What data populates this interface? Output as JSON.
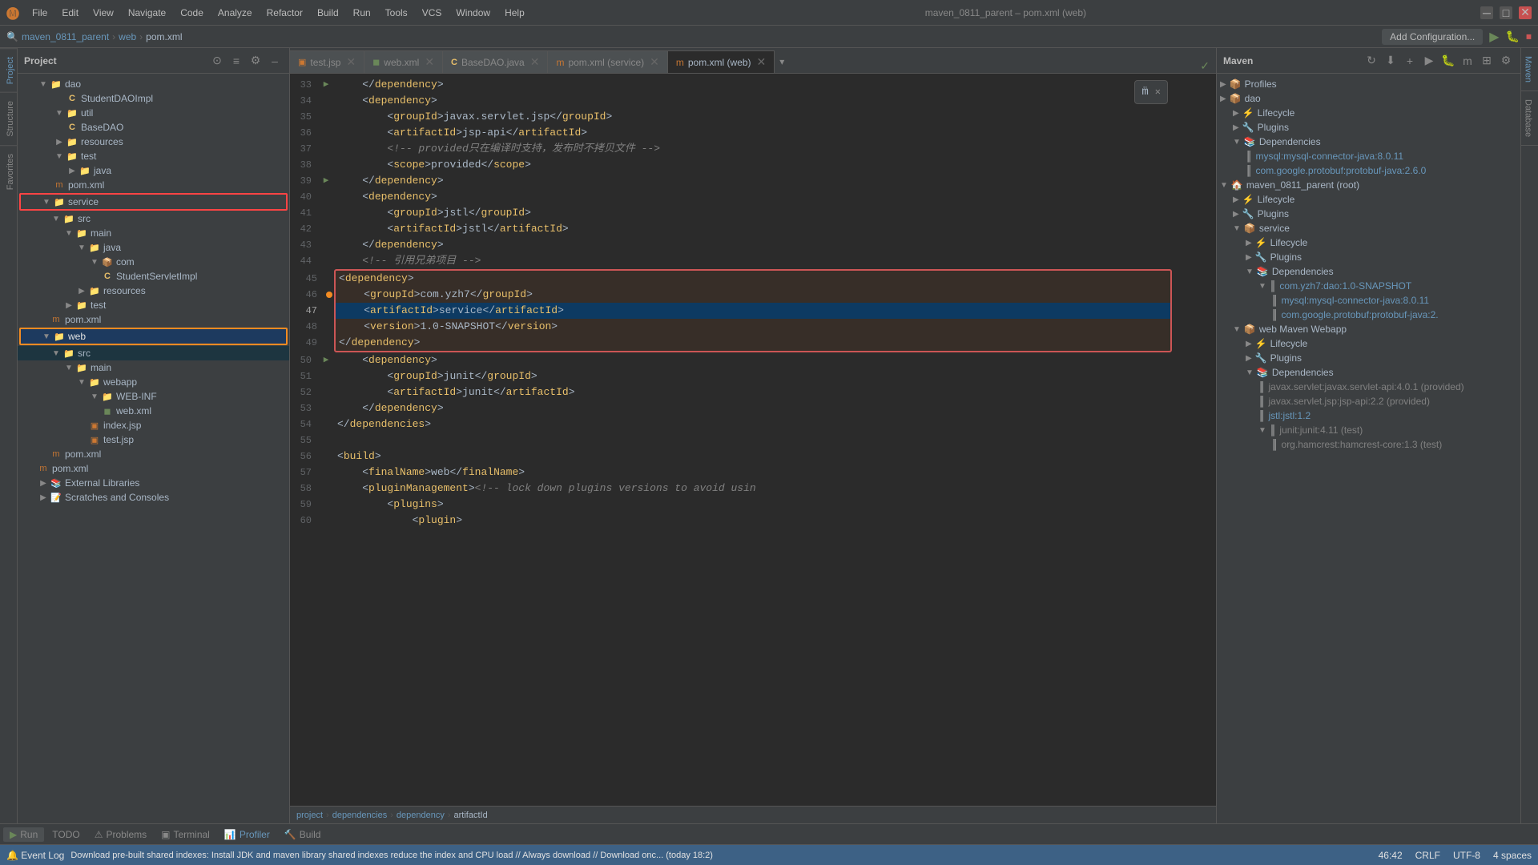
{
  "titlebar": {
    "project": "maven_0811_parent",
    "separator1": "–",
    "file": "pom.xml (web)",
    "logo": "🅜"
  },
  "menu": {
    "items": [
      "File",
      "Edit",
      "View",
      "Navigate",
      "Code",
      "Analyze",
      "Refactor",
      "Build",
      "Run",
      "Tools",
      "VCS",
      "Window",
      "Help"
    ]
  },
  "breadcrumb": {
    "parts": [
      "maven_0811_parent",
      "web",
      "pom.xml"
    ]
  },
  "tabs": [
    {
      "label": "test.jsp",
      "icon": "jsp",
      "active": false,
      "closable": true
    },
    {
      "label": "web.xml",
      "icon": "xml",
      "active": false,
      "closable": true
    },
    {
      "label": "BaseDAO.java",
      "icon": "java",
      "active": false,
      "closable": true
    },
    {
      "label": "pom.xml (service)",
      "icon": "xml",
      "active": false,
      "closable": true
    },
    {
      "label": "pom.xml (web)",
      "icon": "xml",
      "active": true,
      "closable": true
    }
  ],
  "editor": {
    "lines": [
      {
        "num": 33,
        "content": "    </dependency>",
        "type": "normal"
      },
      {
        "num": 34,
        "content": "    <dependency>",
        "type": "normal"
      },
      {
        "num": 35,
        "content": "        <groupId>javax.servlet.jsp</groupId>",
        "type": "normal"
      },
      {
        "num": 36,
        "content": "        <artifactId>jsp-api</artifactId>",
        "type": "normal"
      },
      {
        "num": 37,
        "content": "        <!-- provided只在编译时支持，发布时不拷贝文件 -->",
        "type": "comment"
      },
      {
        "num": 38,
        "content": "        <scope>provided</scope>",
        "type": "normal"
      },
      {
        "num": 39,
        "content": "    </dependency>",
        "type": "normal",
        "gutter": true
      },
      {
        "num": 40,
        "content": "    <dependency>",
        "type": "normal"
      },
      {
        "num": 41,
        "content": "        <groupId>jstl</groupId>",
        "type": "normal"
      },
      {
        "num": 42,
        "content": "        <artifactId>jstl</artifactId>",
        "type": "normal"
      },
      {
        "num": 43,
        "content": "    </dependency>",
        "type": "normal"
      },
      {
        "num": 44,
        "content": "    <!-- 引用兄弟项目 -->",
        "type": "comment"
      },
      {
        "num": 45,
        "content": "    <dependency>",
        "type": "highlight"
      },
      {
        "num": 46,
        "content": "        <groupId>com.yzh7</groupId>",
        "type": "highlight"
      },
      {
        "num": 47,
        "content": "        <artifactId>service</artifactId>",
        "type": "highlight-current"
      },
      {
        "num": 48,
        "content": "        <version>1.0-SNAPSHOT</version>",
        "type": "highlight"
      },
      {
        "num": 49,
        "content": "    </dependency>",
        "type": "highlight"
      },
      {
        "num": 50,
        "content": "    <dependency>",
        "type": "normal",
        "gutter": true
      },
      {
        "num": 51,
        "content": "        <groupId>junit</groupId>",
        "type": "normal"
      },
      {
        "num": 52,
        "content": "        <artifactId>junit</artifactId>",
        "type": "normal"
      },
      {
        "num": 53,
        "content": "    </dependency>",
        "type": "normal"
      },
      {
        "num": 54,
        "content": "</dependencies>",
        "type": "normal"
      },
      {
        "num": 55,
        "content": "",
        "type": "normal"
      },
      {
        "num": 56,
        "content": "<build>",
        "type": "normal"
      },
      {
        "num": 57,
        "content": "    <finalName>web</finalName>",
        "type": "normal"
      },
      {
        "num": 58,
        "content": "    <pluginManagement><!-- lock down plugins versions to avoid usin",
        "type": "normal"
      },
      {
        "num": 59,
        "content": "        <plugins>",
        "type": "normal"
      },
      {
        "num": 60,
        "content": "            <plugin>",
        "type": "normal"
      }
    ]
  },
  "sidebar": {
    "title": "Project",
    "items": [
      {
        "label": "dao",
        "type": "folder",
        "indent": 1,
        "expanded": true
      },
      {
        "label": "StudentDAOImpl",
        "type": "java",
        "indent": 3
      },
      {
        "label": "util",
        "type": "folder",
        "indent": 2,
        "expanded": true
      },
      {
        "label": "BaseDAO",
        "type": "java",
        "indent": 3
      },
      {
        "label": "resources",
        "type": "folder",
        "indent": 2
      },
      {
        "label": "test",
        "type": "folder",
        "indent": 2,
        "expanded": true
      },
      {
        "label": "java",
        "type": "folder-src",
        "indent": 3
      },
      {
        "label": "pom.xml",
        "type": "xml",
        "indent": 2
      },
      {
        "label": "service",
        "type": "folder",
        "indent": 1,
        "expanded": true,
        "highlighted": true
      },
      {
        "label": "src",
        "type": "folder-src",
        "indent": 2,
        "expanded": true
      },
      {
        "label": "main",
        "type": "folder",
        "indent": 3,
        "expanded": true
      },
      {
        "label": "java",
        "type": "folder-src",
        "indent": 4,
        "expanded": true
      },
      {
        "label": "com",
        "type": "pkg",
        "indent": 5,
        "expanded": true
      },
      {
        "label": "StudentServletImpl",
        "type": "java",
        "indent": 6
      },
      {
        "label": "resources",
        "type": "folder",
        "indent": 4
      },
      {
        "label": "test",
        "type": "folder",
        "indent": 3
      },
      {
        "label": "pom.xml",
        "type": "xml",
        "indent": 2
      },
      {
        "label": "web",
        "type": "folder",
        "indent": 1,
        "expanded": true,
        "selected": true
      },
      {
        "label": "src",
        "type": "folder-src",
        "indent": 2,
        "expanded": true
      },
      {
        "label": "main",
        "type": "folder",
        "indent": 3,
        "expanded": true
      },
      {
        "label": "webapp",
        "type": "folder",
        "indent": 4,
        "expanded": true
      },
      {
        "label": "WEB-INF",
        "type": "folder",
        "indent": 5,
        "expanded": true
      },
      {
        "label": "web.xml",
        "type": "xml",
        "indent": 6
      },
      {
        "label": "index.jsp",
        "type": "jsp",
        "indent": 5
      },
      {
        "label": "test.jsp",
        "type": "jsp",
        "indent": 5
      },
      {
        "label": "pom.xml",
        "type": "xml",
        "indent": 2
      },
      {
        "label": "pom.xml",
        "type": "xml",
        "indent": 1
      },
      {
        "label": "External Libraries",
        "type": "lib",
        "indent": 1
      },
      {
        "label": "Scratches and Consoles",
        "type": "lib",
        "indent": 1
      }
    ]
  },
  "maven": {
    "title": "Maven",
    "sections": [
      {
        "label": "Profiles",
        "expanded": true
      },
      {
        "label": "dao",
        "expanded": false
      },
      {
        "label": "Lifecycle",
        "expanded": false
      },
      {
        "label": "Plugins",
        "expanded": false
      },
      {
        "label": "Dependencies",
        "expanded": true,
        "children": [
          {
            "label": "mysql:mysql-connector-java:8.0.11",
            "type": "dep"
          },
          {
            "label": "com.google.protobuf:protobuf-java:2.6.0",
            "type": "dep"
          }
        ]
      },
      {
        "label": "maven_0811_parent (root)",
        "expanded": true,
        "children": [
          {
            "label": "Lifecycle",
            "expanded": false
          },
          {
            "label": "Plugins",
            "expanded": false
          },
          {
            "label": "service",
            "expanded": true,
            "children": [
              {
                "label": "Lifecycle",
                "type": "item"
              },
              {
                "label": "Plugins",
                "type": "item"
              },
              {
                "label": "Dependencies",
                "expanded": true,
                "children": [
                  {
                    "label": "com.yzh7:dao:1.0-SNAPSHOT",
                    "type": "dep",
                    "expanded": true,
                    "children": [
                      {
                        "label": "mysql:mysql-connector-java:8.0.11",
                        "type": "dep2"
                      },
                      {
                        "label": "com.google.protobuf:protobuf-java:2.",
                        "type": "dep2"
                      }
                    ]
                  }
                ]
              }
            ]
          },
          {
            "label": "web Maven Webapp",
            "expanded": true,
            "children": [
              {
                "label": "Lifecycle",
                "type": "item"
              },
              {
                "label": "Plugins",
                "type": "item"
              },
              {
                "label": "Dependencies",
                "expanded": true,
                "children": [
                  {
                    "label": "javax.servlet:javax.servlet-api:4.0.1 (provided)",
                    "type": "dep"
                  },
                  {
                    "label": "javax.servlet.jsp:jsp-api:2.2 (provided)",
                    "type": "dep"
                  },
                  {
                    "label": "jstl:jstl:1.2",
                    "type": "dep"
                  },
                  {
                    "label": "junit:junit:4.11 (test)",
                    "type": "dep",
                    "expanded": true,
                    "children": [
                      {
                        "label": "org.hamcrest:hamcrest-core:1.3 (test)",
                        "type": "dep2"
                      }
                    ]
                  }
                ]
              }
            ]
          }
        ]
      }
    ]
  },
  "bottom_breadcrumb": {
    "parts": [
      "project",
      "dependencies",
      "dependency",
      "artifactId"
    ]
  },
  "bottom_toolbar": {
    "buttons": [
      {
        "label": "Run",
        "icon": "▶"
      },
      {
        "label": "TODO"
      },
      {
        "label": "Problems"
      },
      {
        "label": "Terminal"
      },
      {
        "label": "Profiler"
      },
      {
        "label": "Build"
      }
    ]
  },
  "status_bar": {
    "message": "Download pre-built shared indexes: Install JDK and maven library shared indexes reduce the index and CPU load // Always download // Download onc... (today 18:2)",
    "position": "46:42",
    "crlf": "CRLF",
    "encoding": "UTF-8",
    "indent": "4 spaces"
  },
  "notification": {
    "icon": "m̈",
    "close": "✕"
  },
  "left_side_tabs": [
    "Project",
    "Structure",
    "Favorites"
  ],
  "right_side_tabs": [
    "Maven",
    "Database"
  ]
}
